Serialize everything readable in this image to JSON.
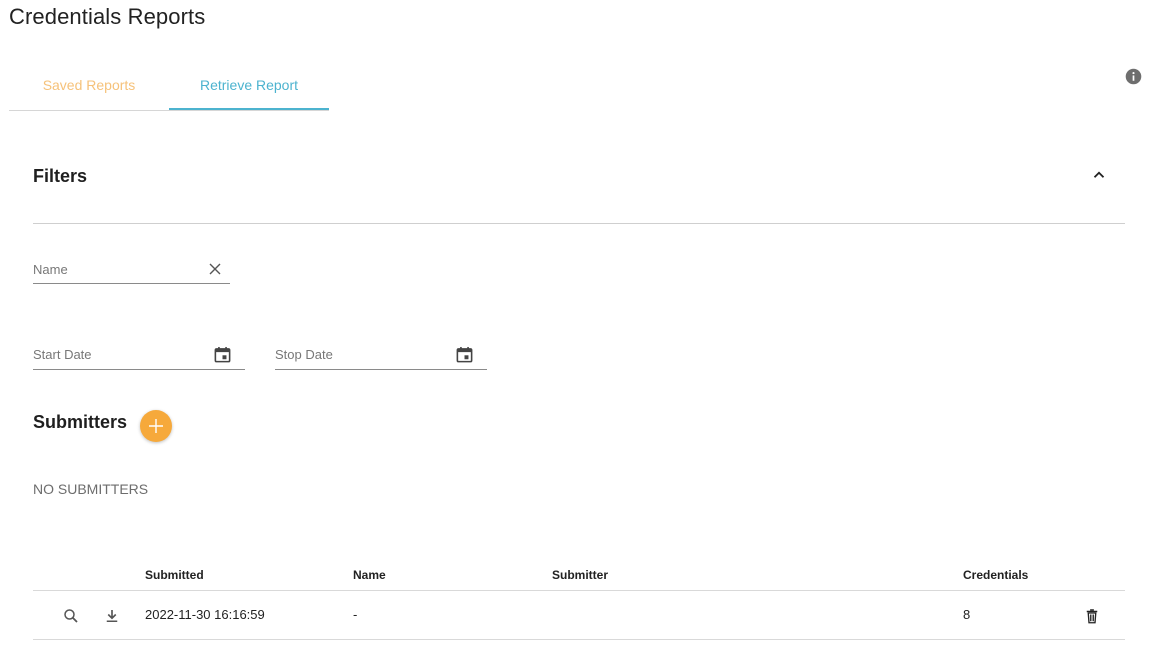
{
  "page": {
    "title": "Credentials Reports"
  },
  "tabs": [
    {
      "label": "Saved Reports",
      "active": false
    },
    {
      "label": "Retrieve Report",
      "active": true
    }
  ],
  "filters": {
    "title": "Filters",
    "name_placeholder": "Name",
    "start_date_placeholder": "Start Date",
    "stop_date_placeholder": "Stop Date"
  },
  "submitters": {
    "title": "Submitters",
    "empty_text": "NO SUBMITTERS"
  },
  "table": {
    "columns": {
      "submitted": "Submitted",
      "name": "Name",
      "submitter": "Submitter",
      "credentials": "Credentials"
    },
    "rows": [
      {
        "submitted": "2022-11-30 16:16:59",
        "name": "-",
        "submitter": "",
        "credentials": "8"
      }
    ]
  },
  "colors": {
    "accent_blue": "#4cb3cf",
    "accent_orange": "#f6a93b",
    "inactive_tab": "#f6c27a"
  },
  "icons": [
    "info-icon",
    "chevron-up-icon",
    "close-icon",
    "calendar-icon",
    "plus-icon",
    "search-icon",
    "download-icon",
    "trash-icon"
  ]
}
